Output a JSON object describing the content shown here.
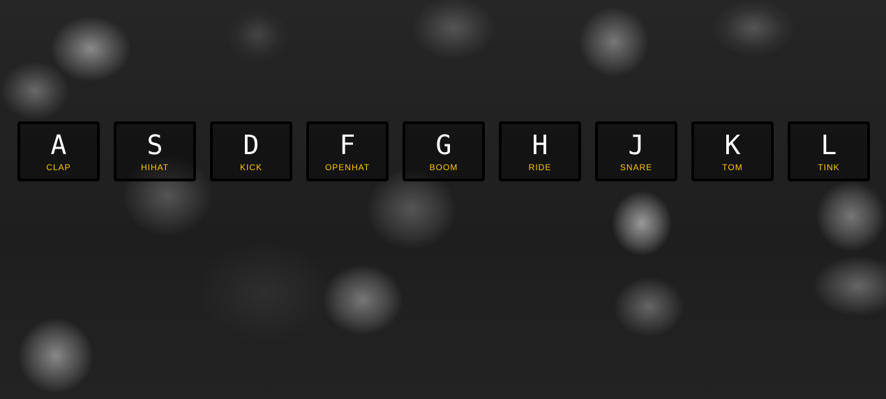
{
  "theme": {
    "key_border": "#000000",
    "key_letter_color": "#ffffff",
    "sound_label_color": "#ffc600",
    "background_color": "#1f1f1f"
  },
  "keys": [
    {
      "letter": "A",
      "sound": "CLAP"
    },
    {
      "letter": "S",
      "sound": "HIHAT"
    },
    {
      "letter": "D",
      "sound": "KICK"
    },
    {
      "letter": "F",
      "sound": "OPENHAT"
    },
    {
      "letter": "G",
      "sound": "BOOM"
    },
    {
      "letter": "H",
      "sound": "RIDE"
    },
    {
      "letter": "J",
      "sound": "SNARE"
    },
    {
      "letter": "K",
      "sound": "TOM"
    },
    {
      "letter": "L",
      "sound": "TINK"
    }
  ]
}
